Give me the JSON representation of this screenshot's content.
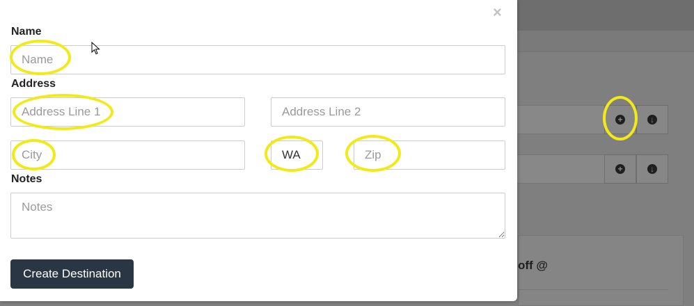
{
  "modal": {
    "close_symbol": "×",
    "labels": {
      "name": "Name",
      "address": "Address",
      "notes": "Notes"
    },
    "fields": {
      "name_placeholder": "Name",
      "address_line1_placeholder": "Address Line 1",
      "address_line2_placeholder": "Address Line 2",
      "city_placeholder": "City",
      "state_value": "WA",
      "zip_placeholder": "Zip",
      "notes_placeholder": "Notes"
    },
    "submit_label": "Create Destination"
  },
  "background": {
    "card_text": "off @",
    "button_icons": [
      "plus-circle-icon",
      "download-circle-icon",
      "plus-circle-icon",
      "download-circle-icon"
    ]
  },
  "colors": {
    "highlight": "#f2ea16",
    "submit_bg": "#2b3645",
    "overlay": "#7f7f7f"
  }
}
